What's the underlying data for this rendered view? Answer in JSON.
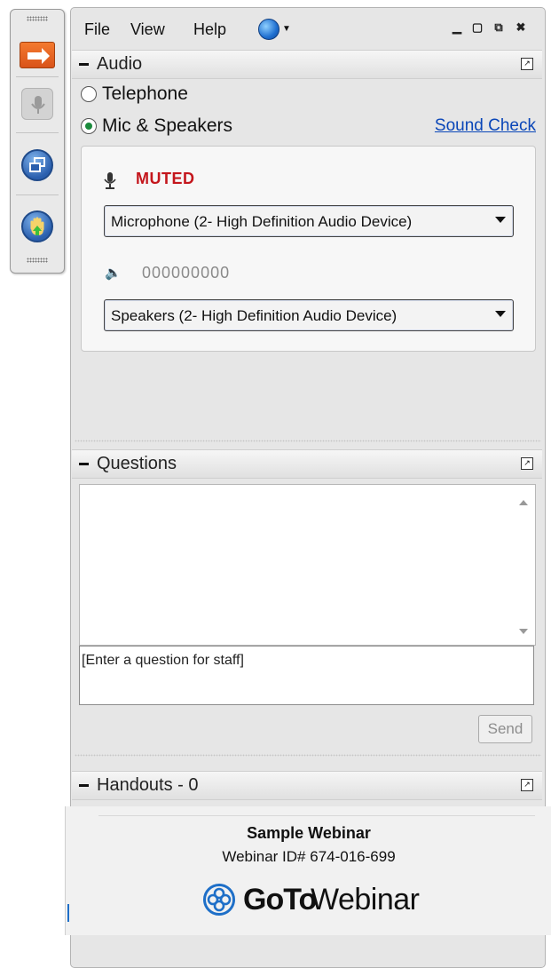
{
  "menu": {
    "file": "File",
    "view": "View",
    "help": "Help"
  },
  "audio": {
    "title": "Audio",
    "telephone": "Telephone",
    "mic_speakers": "Mic & Speakers",
    "selected": "Mic & Speakers",
    "sound_check": "Sound Check",
    "status": "MUTED",
    "microphone_device": "Microphone (2- High Definition Audio Device)",
    "level_dots": "000000000",
    "speaker_device": "Speakers (2- High Definition Audio Device)"
  },
  "questions": {
    "title": "Questions",
    "input_placeholder": "[Enter a question for staff]",
    "send_label": "Send"
  },
  "handouts": {
    "title": "Handouts - 0"
  },
  "footer": {
    "webinar_title": "Sample Webinar",
    "webinar_id": "Webinar ID# 674-016-699",
    "brand_bold": "GoTo",
    "brand_light": "Webinar"
  },
  "colors": {
    "muted": "#c4161c",
    "link": "#0a46b8",
    "arrow_button": "#f47a2f",
    "radio_on": "#1a8a3c"
  },
  "icons": [
    "arrow-right-icon",
    "microphone-icon",
    "screen-icon",
    "raise-hand-icon",
    "globe-icon",
    "minimize-icon",
    "maximize-icon",
    "popout-icon",
    "close-icon",
    "speaker-icon",
    "gotowebinar-logo-icon"
  ]
}
